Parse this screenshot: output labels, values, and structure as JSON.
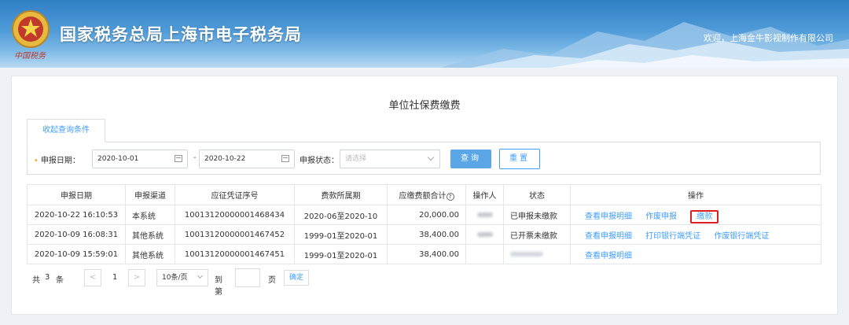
{
  "header": {
    "site_title": "国家税务总局上海市电子税务局",
    "logo_caption": "中国税务",
    "welcome": "欢迎，上海金牛影视制作有限公司"
  },
  "page": {
    "title": "单位社保费缴费"
  },
  "filter": {
    "tab_label": "收起查询条件",
    "date_label": "申报日期：",
    "date_from": "2020-10-01",
    "date_sep": "-",
    "date_to": "2020-10-22",
    "status_label": "申报状态：",
    "status_placeholder": "请选择",
    "query_button": "查询",
    "reset_button": "重置"
  },
  "table": {
    "columns": [
      "申报日期",
      "申报渠道",
      "应征凭证序号",
      "费款所属期",
      "应缴费额合计",
      "操作人",
      "状态",
      "操作"
    ],
    "rows": [
      {
        "date": "2020-10-22 16:10:53",
        "channel": "本系统",
        "voucher": "10013120000001468434",
        "period": "2020-06至2020-10",
        "amount": "20,000.00",
        "status": "已申报未缴款",
        "ops": [
          "查看申报明细",
          "作废申报",
          "缴款"
        ]
      },
      {
        "date": "2020-10-09 16:08:31",
        "channel": "其他系统",
        "voucher": "10013120000001467452",
        "period": "1999-01至2020-01",
        "amount": "38,400.00",
        "status": "已开票未缴款",
        "ops": [
          "查看申报明细",
          "打印银行端凭证",
          "作废银行端凭证"
        ]
      },
      {
        "date": "2020-10-09 15:59:01",
        "channel": "其他系统",
        "voucher": "10013120000001467451",
        "period": "1999-01至2020-01",
        "amount": "38,400.00",
        "status": "",
        "ops": [
          "查看申报明细"
        ]
      }
    ]
  },
  "pager": {
    "total_prefix": "共",
    "total": "3",
    "total_suffix": "条",
    "prev": "<",
    "current": "1",
    "next": ">",
    "page_size": "10条/页",
    "goto_prefix": "到第",
    "goto_suffix": "页",
    "confirm": "确定"
  },
  "colors": {
    "primary": "#409eff",
    "header_blue": "#2f7fc4",
    "highlight_red": "#e02020"
  }
}
